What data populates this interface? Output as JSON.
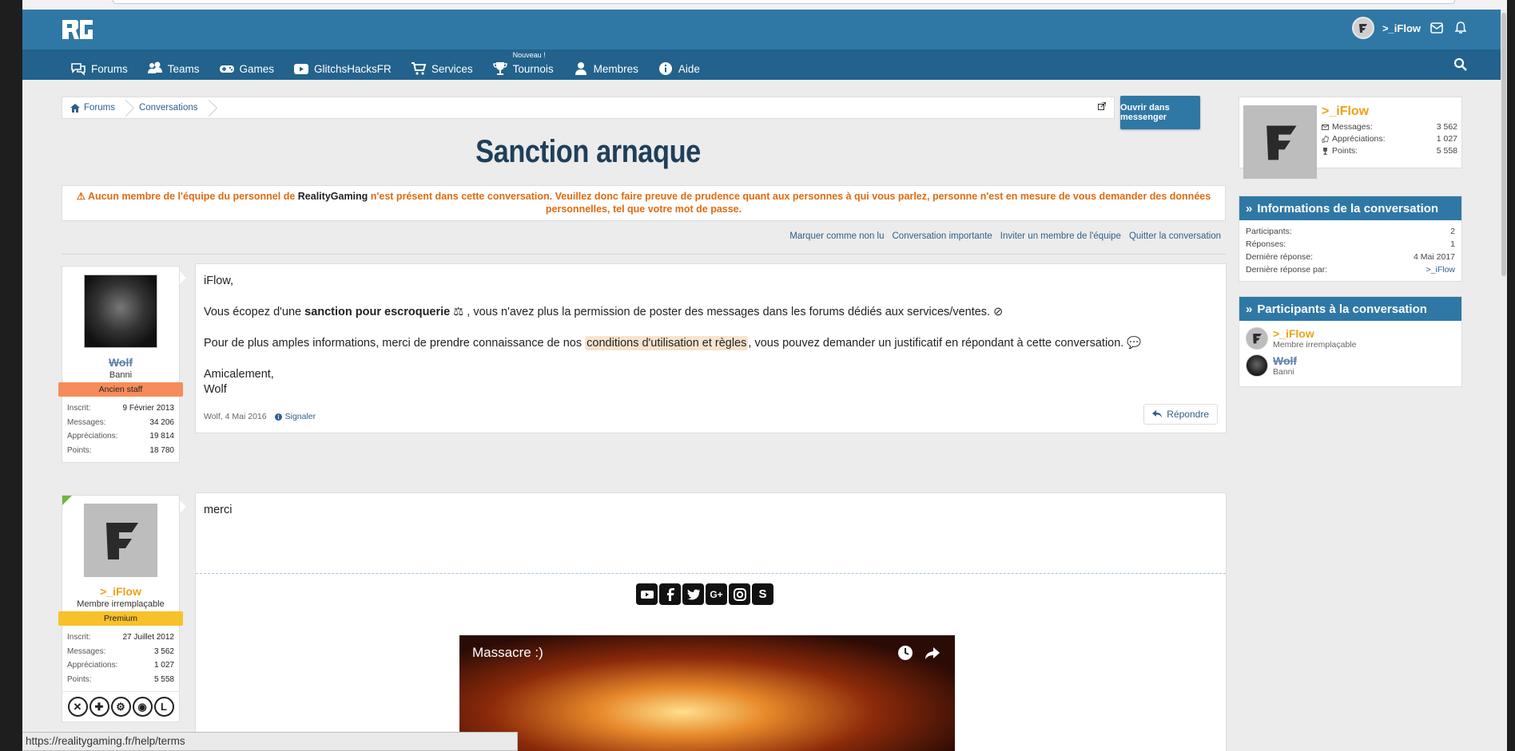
{
  "header": {
    "logo_text": "RG",
    "username": ">_iFlow"
  },
  "nav": {
    "items": [
      {
        "label": "Forums",
        "icon": "comments-icon"
      },
      {
        "label": "Teams",
        "icon": "users-icon"
      },
      {
        "label": "Games",
        "icon": "gamepad-icon"
      },
      {
        "label": "GlitchsHacksFR",
        "icon": "youtube-icon"
      },
      {
        "label": "Services",
        "icon": "cart-icon"
      },
      {
        "label": "Tournois",
        "icon": "trophy-icon",
        "badge": "Nouveau !"
      },
      {
        "label": "Membres",
        "icon": "user-icon"
      },
      {
        "label": "Aide",
        "icon": "info-icon"
      }
    ]
  },
  "breadcrumb": [
    {
      "label": "Forums"
    },
    {
      "label": "Conversations"
    }
  ],
  "messenger_button": "Ouvrir dans messenger",
  "title": "Sanction arnaque",
  "warning": {
    "before": "Aucun membre de l'équipe du personnel de ",
    "brand": "RealityGaming",
    "after": " n'est présent dans cette conversation. Veuillez donc faire preuve de prudence quant aux personnes à qui vous parlez, personne n'est en mesure de vous demander des données personnelles, tel que votre mot de passe."
  },
  "actions": [
    "Marquer comme non lu",
    "Conversation importante",
    "Inviter un membre de l'équipe",
    "Quitter la conversation"
  ],
  "posts": [
    {
      "author": {
        "name": "Wolf",
        "title": "Banni",
        "ribbon": "Ancien staff",
        "stats": [
          {
            "k": "Inscrit:",
            "v": "9 Février 2013"
          },
          {
            "k": "Messages:",
            "v": "34 206"
          },
          {
            "k": "Appréciations:",
            "v": "19 814"
          },
          {
            "k": "Points:",
            "v": "18 780"
          }
        ]
      },
      "greeting": "iFlow,",
      "p1_before": "Vous écopez d'une ",
      "p1_bold": "sanction pour escroquerie",
      "p1_after": " ⚖ , vous n'avez plus la permission de poster des messages dans les forums dédiés aux services/ventes. ⊘",
      "p2_before": "Pour de plus amples informations, merci de prendre connaissance de nos ",
      "p2_link": "conditions d'utilisation et règles",
      "p2_after": ", vous pouvez demander un justificatif en répondant à cette conversation. 💬",
      "closing1": "Amicalement,",
      "closing2": "Wolf",
      "meta": "Wolf, 4 Mai 2016",
      "report": "Signaler",
      "reply": "Répondre"
    },
    {
      "author": {
        "name": ">_iFlow",
        "title": "Membre irremplaçable",
        "ribbon": "Premium",
        "stats": [
          {
            "k": "Inscrit:",
            "v": "27 Juillet 2012"
          },
          {
            "k": "Messages:",
            "v": "3 562"
          },
          {
            "k": "Appréciations:",
            "v": "1 027"
          },
          {
            "k": "Points:",
            "v": "5 558"
          }
        ]
      },
      "text": "merci",
      "video_title": "Massacre :)"
    }
  ],
  "sidebar": {
    "user": {
      "name": ">_iFlow",
      "stats": [
        {
          "k": "Messages:",
          "v": "3 562"
        },
        {
          "k": "Appréciations:",
          "v": "1 027"
        },
        {
          "k": "Points:",
          "v": "5 558"
        }
      ]
    },
    "info": {
      "title": "Informations de la conversation",
      "rows": [
        {
          "k": "Participants:",
          "v": "2"
        },
        {
          "k": "Réponses:",
          "v": "1"
        },
        {
          "k": "Dernière réponse:",
          "v": "4 Mai 2017"
        },
        {
          "k": "Dernière réponse par:",
          "v": ">_iFlow"
        }
      ]
    },
    "participants": {
      "title": "Participants à la conversation",
      "list": [
        {
          "name": ">_iFlow",
          "title": "Membre irremplaçable"
        },
        {
          "name": "Wolf",
          "title": "Banni"
        }
      ]
    }
  },
  "status_url": "https://realitygaming.fr/help/terms",
  "colors": {
    "header": "#2f78a5",
    "nav": "#22628c",
    "warning": "#e06b12",
    "username_orange": "#f0a01a",
    "link": "#2f5f8a"
  }
}
